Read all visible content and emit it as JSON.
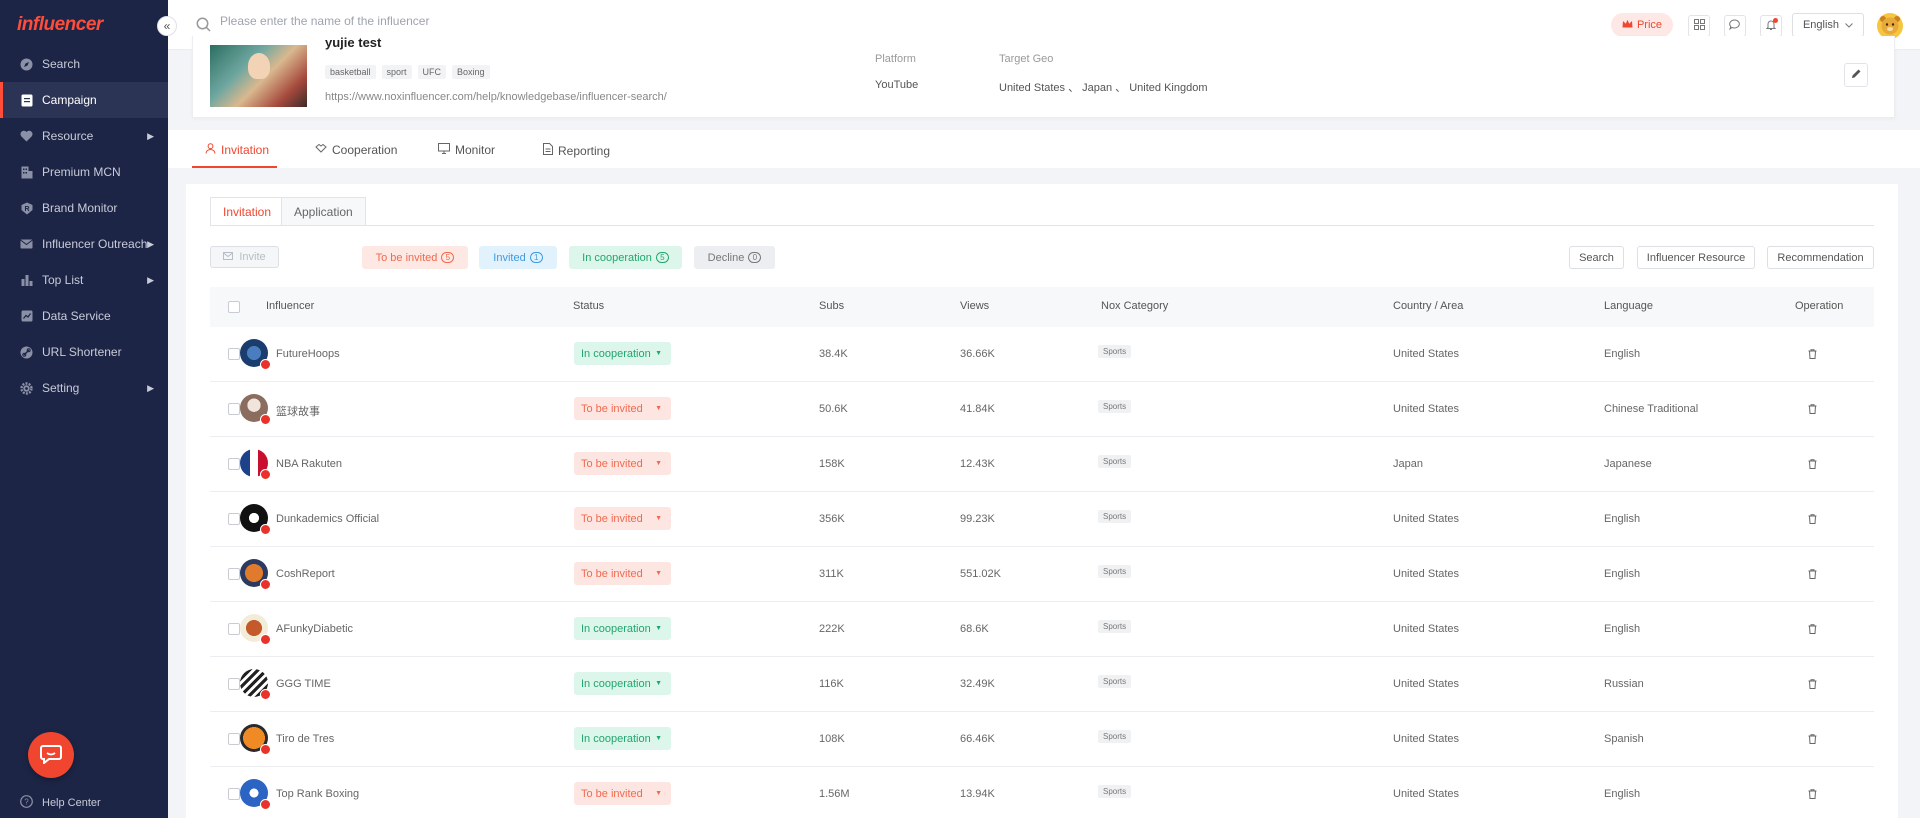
{
  "app": {
    "logo_text": "influencer"
  },
  "sidebar": {
    "items": [
      {
        "label": "Search",
        "icon": "compass-icon"
      },
      {
        "label": "Campaign",
        "icon": "campaign-icon"
      },
      {
        "label": "Resource",
        "icon": "heart-icon"
      },
      {
        "label": "Premium MCN",
        "icon": "building-icon"
      },
      {
        "label": "Brand Monitor",
        "icon": "brand-r-icon"
      },
      {
        "label": "Influencer Outreach",
        "icon": "mail-icon"
      },
      {
        "label": "Top List",
        "icon": "bar-chart-icon"
      },
      {
        "label": "Data Service",
        "icon": "data-icon"
      },
      {
        "label": "URL Shortener",
        "icon": "link-icon"
      },
      {
        "label": "Setting",
        "icon": "gear-icon"
      }
    ],
    "help_label": "Help Center"
  },
  "topbar": {
    "search_placeholder": "Please enter the name of the influencer",
    "price_label": "Price",
    "language": "English"
  },
  "campaign": {
    "title": "yujie test",
    "tags": [
      "basketball",
      "sport",
      "UFC",
      "Boxing"
    ],
    "url": "https://www.noxinfluencer.com/help/knowledgebase/influencer-search/",
    "platform_label": "Platform",
    "platform_value": "YouTube",
    "geo_label": "Target Geo",
    "geo_value": "United States 、 Japan 、 United Kingdom"
  },
  "main_tabs": [
    {
      "label": "Invitation"
    },
    {
      "label": "Cooperation"
    },
    {
      "label": "Monitor"
    },
    {
      "label": "Reporting"
    }
  ],
  "sub_tabs": [
    {
      "label": "Invitation"
    },
    {
      "label": "Application"
    }
  ],
  "toolbar": {
    "invite_label": "Invite",
    "filters": [
      {
        "label": "To be invited",
        "count": "5"
      },
      {
        "label": "Invited",
        "count": "1"
      },
      {
        "label": "In cooperation",
        "count": "5"
      },
      {
        "label": "Decline",
        "count": "0"
      }
    ],
    "search_label": "Search",
    "resource_label": "Influencer Resource",
    "recommendation_label": "Recommendation"
  },
  "table": {
    "headers": [
      "Influencer",
      "Status",
      "Subs",
      "Views",
      "Nox Category",
      "Country / Area",
      "Language",
      "Operation"
    ],
    "rows": [
      {
        "name": "FutureHoops",
        "status": "In cooperation",
        "subs": "38.4K",
        "views": "36.66K",
        "category": "Sports",
        "country": "United States",
        "language": "English"
      },
      {
        "name": "篮球故事",
        "status": "To be invited",
        "subs": "50.6K",
        "views": "41.84K",
        "category": "Sports",
        "country": "United States",
        "language": "Chinese Traditional"
      },
      {
        "name": "NBA Rakuten",
        "status": "To be invited",
        "subs": "158K",
        "views": "12.43K",
        "category": "Sports",
        "country": "Japan",
        "language": "Japanese"
      },
      {
        "name": "Dunkademics Official",
        "status": "To be invited",
        "subs": "356K",
        "views": "99.23K",
        "category": "Sports",
        "country": "United States",
        "language": "English"
      },
      {
        "name": "CoshReport",
        "status": "To be invited",
        "subs": "311K",
        "views": "551.02K",
        "category": "Sports",
        "country": "United States",
        "language": "English"
      },
      {
        "name": "AFunkyDiabetic",
        "status": "In cooperation",
        "subs": "222K",
        "views": "68.6K",
        "category": "Sports",
        "country": "United States",
        "language": "English"
      },
      {
        "name": "GGG TIME",
        "status": "In cooperation",
        "subs": "116K",
        "views": "32.49K",
        "category": "Sports",
        "country": "United States",
        "language": "Russian"
      },
      {
        "name": "Tiro de Tres",
        "status": "In cooperation",
        "subs": "108K",
        "views": "66.46K",
        "category": "Sports",
        "country": "United States",
        "language": "Spanish"
      },
      {
        "name": "Top Rank Boxing",
        "status": "To be invited",
        "subs": "1.56M",
        "views": "13.94K",
        "category": "Sports",
        "country": "United States",
        "language": "English"
      }
    ]
  },
  "colors": {
    "accent": "#f0462f",
    "sidebar_bg": "#1d2546",
    "coop_green": "#22a66e",
    "invite_red": "#f06a4f"
  }
}
